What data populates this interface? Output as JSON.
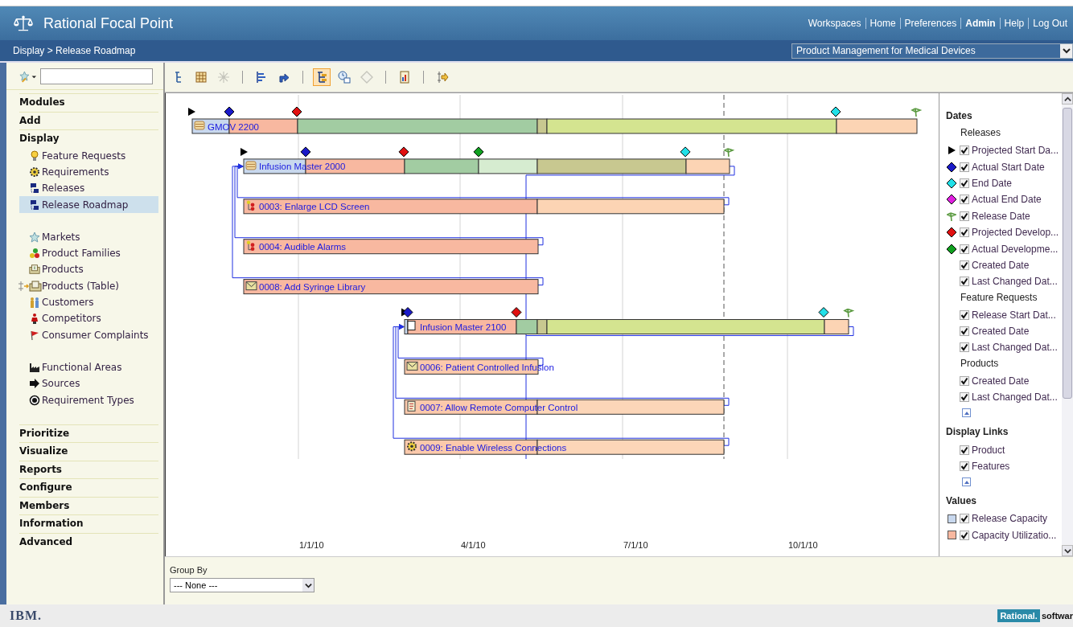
{
  "header": {
    "title": "Rational Focal Point",
    "links": [
      {
        "label": "Workspaces",
        "bold": false
      },
      {
        "label": "Home",
        "bold": false
      },
      {
        "label": "Preferences",
        "bold": false
      },
      {
        "label": "Admin",
        "bold": true
      },
      {
        "label": "Help",
        "bold": false
      },
      {
        "label": "Log Out",
        "bold": false
      }
    ]
  },
  "breadcrumb": "Display > Release Roadmap",
  "workspace_select": {
    "value": "Product Management for Medical Devices"
  },
  "sidebar": {
    "sections": [
      {
        "label": "Modules"
      },
      {
        "label": "Add"
      },
      {
        "label": "Display",
        "groups": [
          [
            {
              "label": "Feature Requests",
              "kind": "bulb",
              "selected": false
            },
            {
              "label": "Requirements",
              "kind": "cog",
              "selected": false
            },
            {
              "label": "Releases",
              "kind": "release",
              "selected": false
            },
            {
              "label": "Release Roadmap",
              "kind": "release",
              "selected": true
            }
          ],
          [
            {
              "label": "Markets",
              "kind": "star",
              "selected": false
            },
            {
              "label": "Product Families",
              "kind": "dots",
              "selected": false
            },
            {
              "label": "Products",
              "kind": "product",
              "selected": false
            },
            {
              "label": "Products (Table)",
              "kind": "product-table",
              "selected": false
            },
            {
              "label": "Customers",
              "kind": "people",
              "selected": false
            },
            {
              "label": "Competitors",
              "kind": "person",
              "selected": false
            },
            {
              "label": "Consumer Complaints",
              "kind": "flag",
              "selected": false
            }
          ],
          [
            {
              "label": "Functional Areas",
              "kind": "factory",
              "selected": false
            },
            {
              "label": "Sources",
              "kind": "arrow",
              "selected": false
            },
            {
              "label": "Requirement Types",
              "kind": "target",
              "selected": false
            }
          ]
        ]
      },
      {
        "label": "Prioritize"
      },
      {
        "label": "Visualize"
      },
      {
        "label": "Reports"
      },
      {
        "label": "Configure"
      },
      {
        "label": "Members"
      },
      {
        "label": "Information"
      },
      {
        "label": "Advanced"
      }
    ]
  },
  "toolbar": [
    [
      {
        "selected": false,
        "disabled": false
      },
      {
        "selected": false,
        "disabled": false
      },
      {
        "selected": false,
        "disabled": true
      }
    ],
    [
      {
        "selected": false,
        "disabled": false
      },
      {
        "selected": false,
        "disabled": false
      }
    ],
    [
      {
        "selected": true,
        "disabled": false
      },
      {
        "selected": false,
        "disabled": false
      },
      {
        "selected": false,
        "disabled": true
      }
    ],
    [
      {
        "selected": false,
        "disabled": false
      }
    ],
    [
      {
        "selected": false,
        "disabled": false
      }
    ]
  ],
  "roadmap": {
    "ticks": [
      "1/1/10",
      "4/1/10",
      "7/1/10",
      "10/1/10"
    ],
    "releases": [
      {
        "label": "GMOV 2200",
        "kind": "release",
        "segments": [
          {
            "color": "#c8d8ee"
          },
          {
            "color": "#f8b8a0"
          },
          {
            "color": "#a2cca2"
          },
          {
            "color": "#c8c890"
          },
          {
            "color": "#d4e490"
          },
          {
            "color": "#fcd4b4"
          }
        ],
        "markers": [
          {
            "kind": "projected-start"
          },
          {
            "kind": "actual-start"
          },
          {
            "kind": "projected-dev"
          },
          {
            "kind": "end"
          },
          {
            "kind": "release"
          }
        ]
      },
      {
        "label": "Infusion Master 2000",
        "kind": "release",
        "segments": [
          {
            "color": "#c8d8ee"
          },
          {
            "color": "#f8b8a0"
          },
          {
            "color": "#a2cca2"
          },
          {
            "color": "#d6ecd0"
          },
          {
            "color": "#c8c890"
          },
          {
            "color": "#fcd4b4"
          }
        ],
        "markers": [
          {
            "kind": "projected-start"
          },
          {
            "kind": "actual-start"
          },
          {
            "kind": "projected-dev"
          },
          {
            "kind": "actual-dev"
          },
          {
            "kind": "end"
          },
          {
            "kind": "release"
          }
        ],
        "children": [
          {
            "label": "0003: Enlarge LCD Screen",
            "kind": "dots",
            "segments": [
              {
                "color": "#f8b8a0"
              },
              {
                "color": "#fcd4b4"
              }
            ]
          },
          {
            "label": "0004: Audible Alarms",
            "kind": "dots",
            "segments": [
              {
                "color": "#f8b8a0"
              }
            ]
          },
          {
            "label": "0008: Add Syringe Library",
            "kind": "envelope",
            "segments": [
              {
                "color": "#f8b8a0"
              }
            ]
          }
        ]
      },
      {
        "label": "Infusion Master 2100",
        "kind": "draft",
        "segments": [
          {
            "color": "#c8d8ee"
          },
          {
            "color": "#f8b8a0"
          },
          {
            "color": "#a2cca2"
          },
          {
            "color": "#c8c890"
          },
          {
            "color": "#d4e490"
          },
          {
            "color": "#fcd4b4"
          }
        ],
        "markers": [
          {
            "kind": "projected-start"
          },
          {
            "kind": "actual-start"
          },
          {
            "kind": "projected-dev"
          },
          {
            "kind": "end"
          },
          {
            "kind": "release"
          }
        ],
        "children": [
          {
            "label": "0006: Patient Controlled Infusion",
            "kind": "envelope",
            "segments": [
              {
                "color": "#fbc9ab"
              }
            ]
          },
          {
            "label": "0007: Allow Remote Computer Control",
            "kind": "document",
            "segments": [
              {
                "color": "#fbc9ab"
              },
              {
                "color": "#fcd6b8"
              }
            ]
          },
          {
            "label": "0009: Enable Wireless Connections",
            "kind": "gear",
            "segments": [
              {
                "color": "#fbc9ab"
              },
              {
                "color": "#fcd6b8"
              }
            ]
          }
        ]
      }
    ]
  },
  "legend": [
    {
      "title": "Dates",
      "groups": [
        {
          "title": "Releases",
          "collapse_button": false,
          "items": [
            {
              "label": "Projected Start Da...",
              "kind": "projected-start",
              "checked": true
            },
            {
              "label": "Actual Start Date",
              "kind": "actual-start",
              "checked": true
            },
            {
              "label": "End Date",
              "kind": "end",
              "checked": true
            },
            {
              "label": "Actual End Date",
              "kind": "actual-end",
              "checked": true
            },
            {
              "label": "Release Date",
              "kind": "release",
              "checked": true
            },
            {
              "label": "Projected Develop...",
              "kind": "projected-dev",
              "checked": true
            },
            {
              "label": "Actual Developme...",
              "kind": "actual-dev",
              "checked": true
            },
            {
              "label": "Created Date",
              "kind": "plain",
              "checked": true
            },
            {
              "label": "Last Changed Dat...",
              "kind": "plain",
              "checked": true
            }
          ]
        },
        {
          "title": "Feature Requests",
          "collapse_button": false,
          "items": [
            {
              "label": "Release Start Dat...",
              "kind": "plain",
              "checked": true
            },
            {
              "label": "Created Date",
              "kind": "plain",
              "checked": true
            },
            {
              "label": "Last Changed Dat...",
              "kind": "plain",
              "checked": true
            }
          ]
        },
        {
          "title": "Products",
          "collapse_button": true,
          "items": [
            {
              "label": "Created Date",
              "kind": "plain",
              "checked": true
            },
            {
              "label": "Last Changed Dat...",
              "kind": "plain",
              "checked": true
            }
          ]
        }
      ]
    },
    {
      "title": "Display Links",
      "groups": [
        {
          "collapse_button": true,
          "items": [
            {
              "label": "Product",
              "kind": "plain",
              "checked": true
            },
            {
              "label": "Features",
              "kind": "plain",
              "checked": true
            }
          ]
        }
      ]
    },
    {
      "title": "Values",
      "groups": [
        {
          "collapse_button": false,
          "items": [
            {
              "label": "Release Capacity",
              "kind": "swatch",
              "color": "#c8d8ee",
              "checked": true
            },
            {
              "label": "Capacity Utilizatio...",
              "kind": "swatch",
              "color": "#f8b8a0",
              "checked": true
            }
          ]
        }
      ]
    }
  ],
  "group_by": {
    "label": "Group By",
    "value": "--- None ---"
  },
  "footer": {
    "brand": "IBM.",
    "product_badge": "Rational.",
    "product_word": "softwar"
  }
}
